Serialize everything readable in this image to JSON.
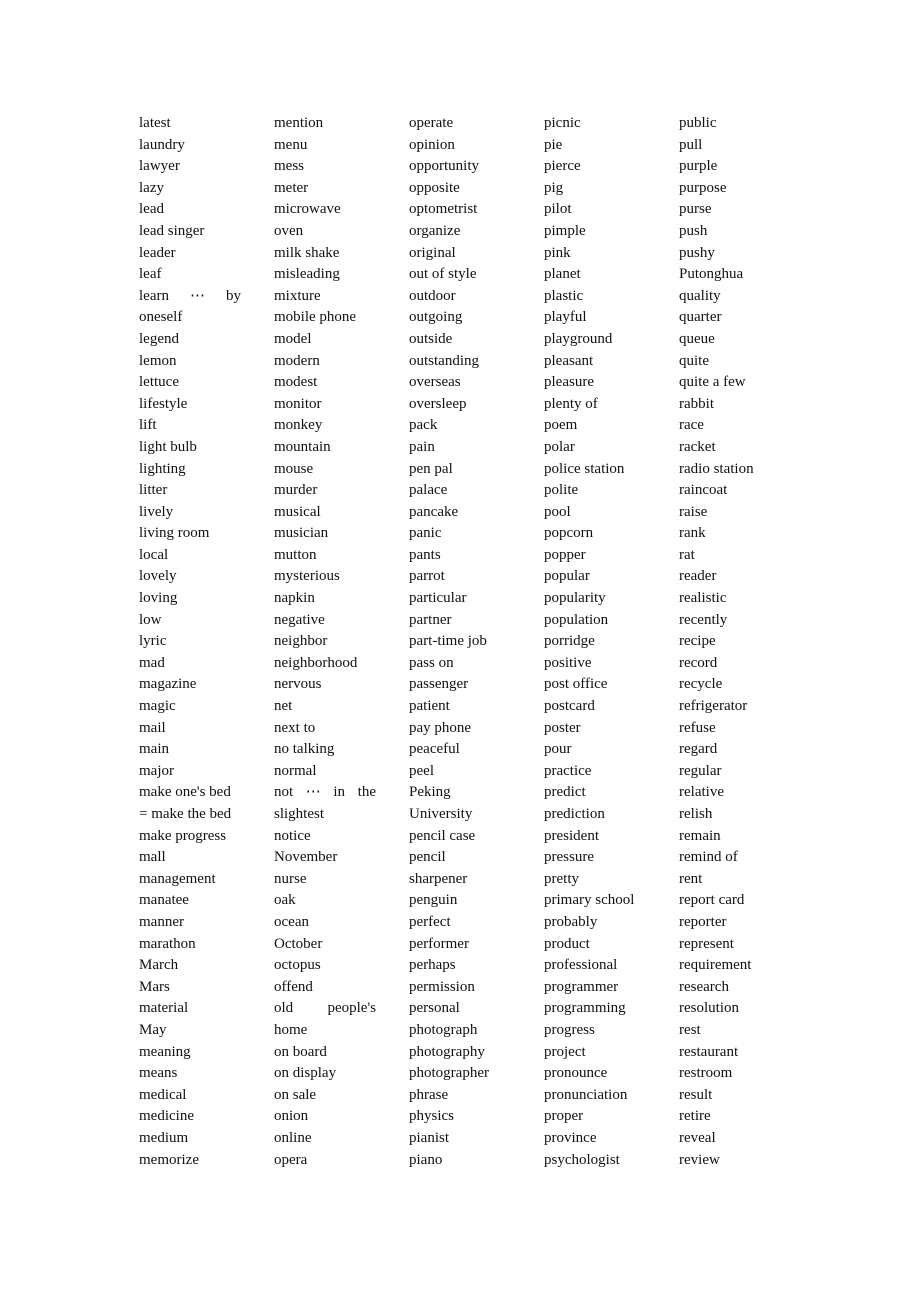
{
  "document": {
    "type": "vocabulary word list",
    "columns": [
      {
        "words": [
          "latest",
          "laundry",
          "lawyer",
          "lazy",
          "lead",
          "lead singer",
          "leader",
          "leaf",
          "learn ⋯ by",
          "oneself",
          "legend",
          "lemon",
          "lettuce",
          "lifestyle",
          "lift",
          "light bulb",
          "lighting",
          "litter",
          "lively",
          "living room",
          "local",
          "lovely",
          "loving",
          "low",
          "lyric",
          "mad",
          "magazine",
          "magic",
          "mail",
          "main",
          "major",
          "make one's bed",
          "= make the bed",
          "make progress",
          "mall",
          "management",
          "manatee",
          "manner",
          "marathon",
          "March",
          "Mars",
          "material",
          "May",
          "meaning",
          "means",
          "medical",
          "medicine",
          "medium",
          "memorize"
        ]
      },
      {
        "words": [
          "mention",
          "menu",
          "mess",
          "meter",
          "microwave",
          "oven",
          "milk shake",
          "misleading",
          "mixture",
          "mobile phone",
          "model",
          "modern",
          "modest",
          "monitor",
          "monkey",
          "mountain",
          "mouse",
          "murder",
          "musical",
          "musician",
          "mutton",
          "mysterious",
          "napkin",
          "negative",
          "neighbor",
          "neighborhood",
          "nervous",
          "net",
          "next to",
          "no talking",
          "normal",
          "not ⋯ in the",
          "slightest",
          "notice",
          "November",
          "nurse",
          "oak",
          "ocean",
          "October",
          "octopus",
          "offend",
          "old people's",
          "home",
          "on board",
          "on display",
          "on sale",
          "onion",
          "online",
          "opera"
        ]
      },
      {
        "words": [
          "operate",
          "opinion",
          "opportunity",
          "opposite",
          "optometrist",
          "organize",
          "original",
          "out of style",
          "outdoor",
          "outgoing",
          "outside",
          "outstanding",
          "overseas",
          "oversleep",
          "pack",
          "pain",
          "pen pal",
          "palace",
          "pancake",
          "panic",
          "pants",
          "parrot",
          "particular",
          "partner",
          "part-time job",
          "pass on",
          "passenger",
          "patient",
          "pay phone",
          "peaceful",
          "peel",
          "Peking",
          "University",
          "pencil case",
          "pencil",
          "sharpener",
          "penguin",
          "perfect",
          "performer",
          "perhaps",
          "permission",
          "personal",
          "photograph",
          "photography",
          "photographer",
          "phrase",
          "physics",
          "pianist",
          "piano"
        ]
      },
      {
        "words": [
          "picnic",
          "pie",
          "pierce",
          "pig",
          "pilot",
          "pimple",
          "pink",
          "planet",
          "plastic",
          "playful",
          "playground",
          "pleasant",
          "pleasure",
          "plenty of",
          "poem",
          "polar",
          "police station",
          "polite",
          "pool",
          "popcorn",
          "popper",
          "popular",
          "popularity",
          "population",
          "porridge",
          "positive",
          "post office",
          "postcard",
          "poster",
          "pour",
          "practice",
          "predict",
          "prediction",
          "president",
          "pressure",
          "pretty",
          "primary school",
          "probably",
          "product",
          "professional",
          "programmer",
          "programming",
          "progress",
          "project",
          "pronounce",
          "pronunciation",
          "proper",
          "province",
          "psychologist"
        ]
      },
      {
        "words": [
          "public",
          "pull",
          "purple",
          "purpose",
          "purse",
          "push",
          "pushy",
          "Putonghua",
          "quality",
          "quarter",
          "queue",
          "quite",
          "quite a few",
          "rabbit",
          "race",
          "racket",
          "radio station",
          "raincoat",
          "raise",
          "rank",
          "rat",
          "reader",
          "realistic",
          "recently",
          "recipe",
          "record",
          "recycle",
          "refrigerator",
          "refuse",
          "regard",
          "regular",
          "relative",
          "relish",
          "remain",
          "remind of",
          "rent",
          "report card",
          "reporter",
          "represent",
          "requirement",
          "research",
          "resolution",
          "rest",
          "restaurant",
          "restroom",
          "result",
          "retire",
          "reveal",
          "review"
        ]
      }
    ],
    "justified_lines": [
      "learn ⋯ by",
      "not ⋯ in the",
      "old people's"
    ]
  }
}
